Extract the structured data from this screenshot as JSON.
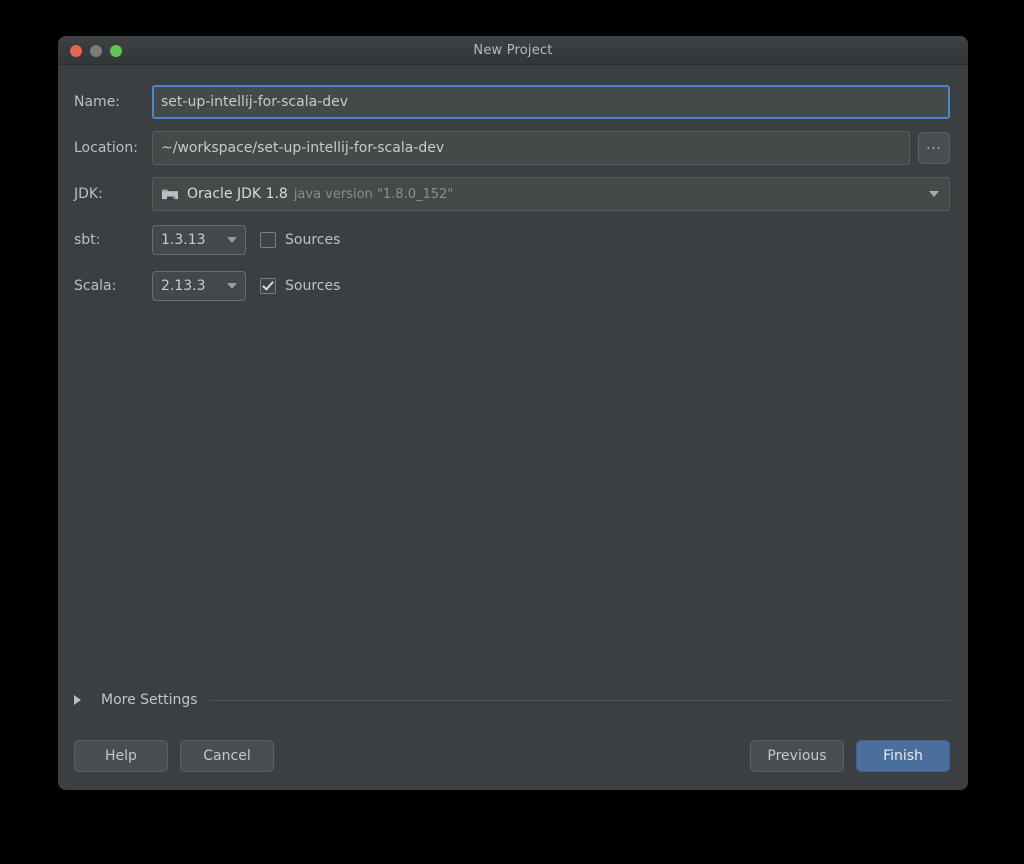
{
  "window": {
    "title": "New Project",
    "traffic_lights": [
      {
        "name": "close",
        "color": "#ea6255"
      },
      {
        "name": "minimize",
        "color": "#7c7c7c"
      },
      {
        "name": "maximize",
        "color": "#62c454"
      }
    ]
  },
  "form": {
    "name": {
      "label": "Name:",
      "value": "set-up-intellij-for-scala-dev",
      "placeholder": "Project name"
    },
    "location": {
      "label": "Location:",
      "value": "~/workspace/set-up-intellij-for-scala-dev",
      "placeholder": "Project location",
      "browse_label": "..."
    },
    "jdk": {
      "label": "JDK:",
      "icon": "jdk-folder-icon",
      "value": "Oracle JDK 1.8",
      "version": "java version \"1.8.0_152\""
    },
    "sbt": {
      "label": "sbt:",
      "value": "1.3.13",
      "sources_label": "Sources",
      "sources_checked": false
    },
    "scala": {
      "label": "Scala:",
      "value": "2.13.3",
      "sources_label": "Sources",
      "sources_checked": true
    }
  },
  "more_settings": {
    "label": "More Settings",
    "expanded": false
  },
  "buttons": {
    "help": "Help",
    "cancel": "Cancel",
    "previous": "Previous",
    "finish": "Finish"
  },
  "colors": {
    "window_bg": "#3c3f41",
    "field_bg": "#45494a",
    "focus_border": "#4a88c7",
    "primary_button": "#4a6f9e",
    "text": "#c8cbcd",
    "muted_text": "#8a8d8f"
  }
}
